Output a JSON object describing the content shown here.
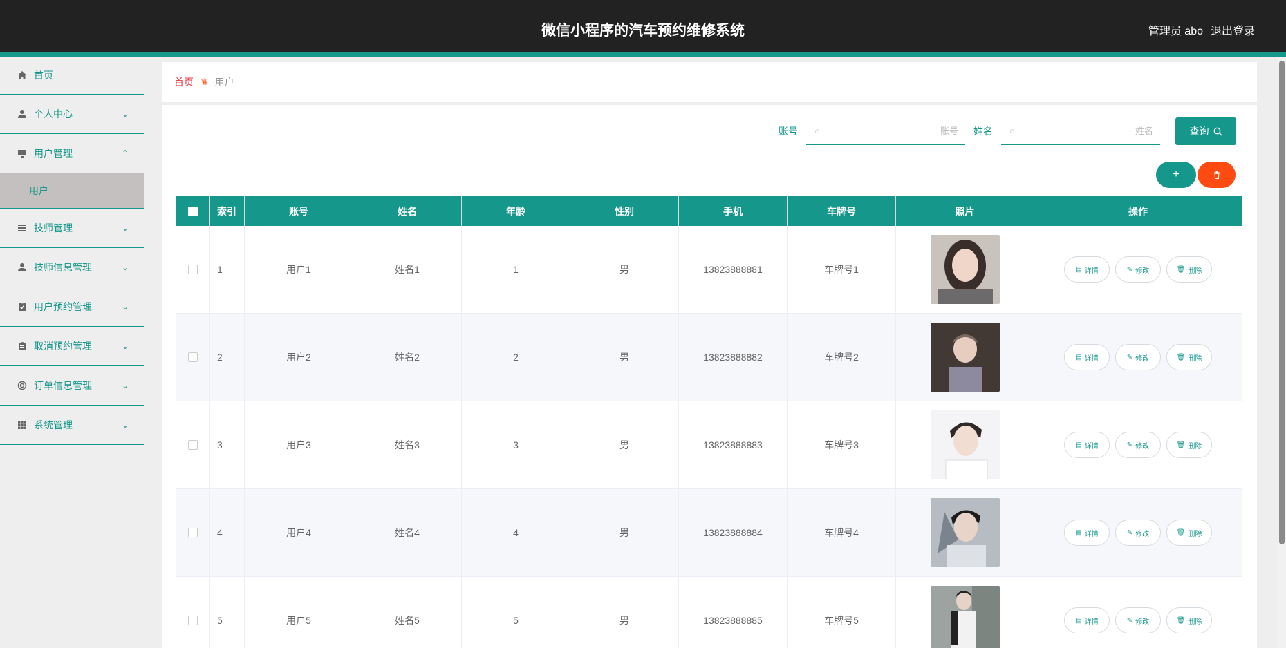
{
  "header": {
    "title": "微信小程序的汽车预约维修系统",
    "admin": "管理员 abo",
    "logout": "退出登录"
  },
  "sidebar": {
    "items": [
      {
        "label": "首页",
        "icon": "home-icon"
      },
      {
        "label": "个人中心",
        "icon": "user-icon"
      },
      {
        "label": "用户管理",
        "icon": "monitor-icon",
        "expanded": true
      },
      {
        "label": "技师管理",
        "icon": "list-icon"
      },
      {
        "label": "技师信息管理",
        "icon": "user-icon"
      },
      {
        "label": "用户预约管理",
        "icon": "clipboard-check-icon"
      },
      {
        "label": "取消预约管理",
        "icon": "clipboard-icon"
      },
      {
        "label": "订单信息管理",
        "icon": "lifebuoy-icon"
      },
      {
        "label": "系统管理",
        "icon": "grid-icon"
      }
    ],
    "submenu": {
      "label": "用户"
    }
  },
  "breadcrumb": {
    "home": "首页",
    "current": "用户"
  },
  "search": {
    "account_label": "账号",
    "account_placeholder": "账号",
    "name_label": "姓名",
    "name_placeholder": "姓名",
    "button": "查询"
  },
  "actions": {
    "add": "+",
    "delete_icon": "trash-icon"
  },
  "table": {
    "headers": [
      "索引",
      "账号",
      "姓名",
      "年龄",
      "性别",
      "手机",
      "车牌号",
      "照片",
      "操作"
    ],
    "rows": [
      {
        "index": "1",
        "account": "用户1",
        "name": "姓名1",
        "age": "1",
        "sex": "男",
        "phone": "13823888881",
        "plate": "车牌号1"
      },
      {
        "index": "2",
        "account": "用户2",
        "name": "姓名2",
        "age": "2",
        "sex": "男",
        "phone": "13823888882",
        "plate": "车牌号2"
      },
      {
        "index": "3",
        "account": "用户3",
        "name": "姓名3",
        "age": "3",
        "sex": "男",
        "phone": "13823888883",
        "plate": "车牌号3"
      },
      {
        "index": "4",
        "account": "用户4",
        "name": "姓名4",
        "age": "4",
        "sex": "男",
        "phone": "13823888884",
        "plate": "车牌号4"
      },
      {
        "index": "5",
        "account": "用户5",
        "name": "姓名5",
        "age": "5",
        "sex": "男",
        "phone": "13823888885",
        "plate": "车牌号5"
      }
    ],
    "op_labels": {
      "detail": "详情",
      "edit": "修改",
      "delete": "删除"
    }
  },
  "colors": {
    "accent": "#16978b",
    "danger": "#ff4b11",
    "header_bg": "#222222",
    "breadcrumb_home": "#e3343b"
  }
}
